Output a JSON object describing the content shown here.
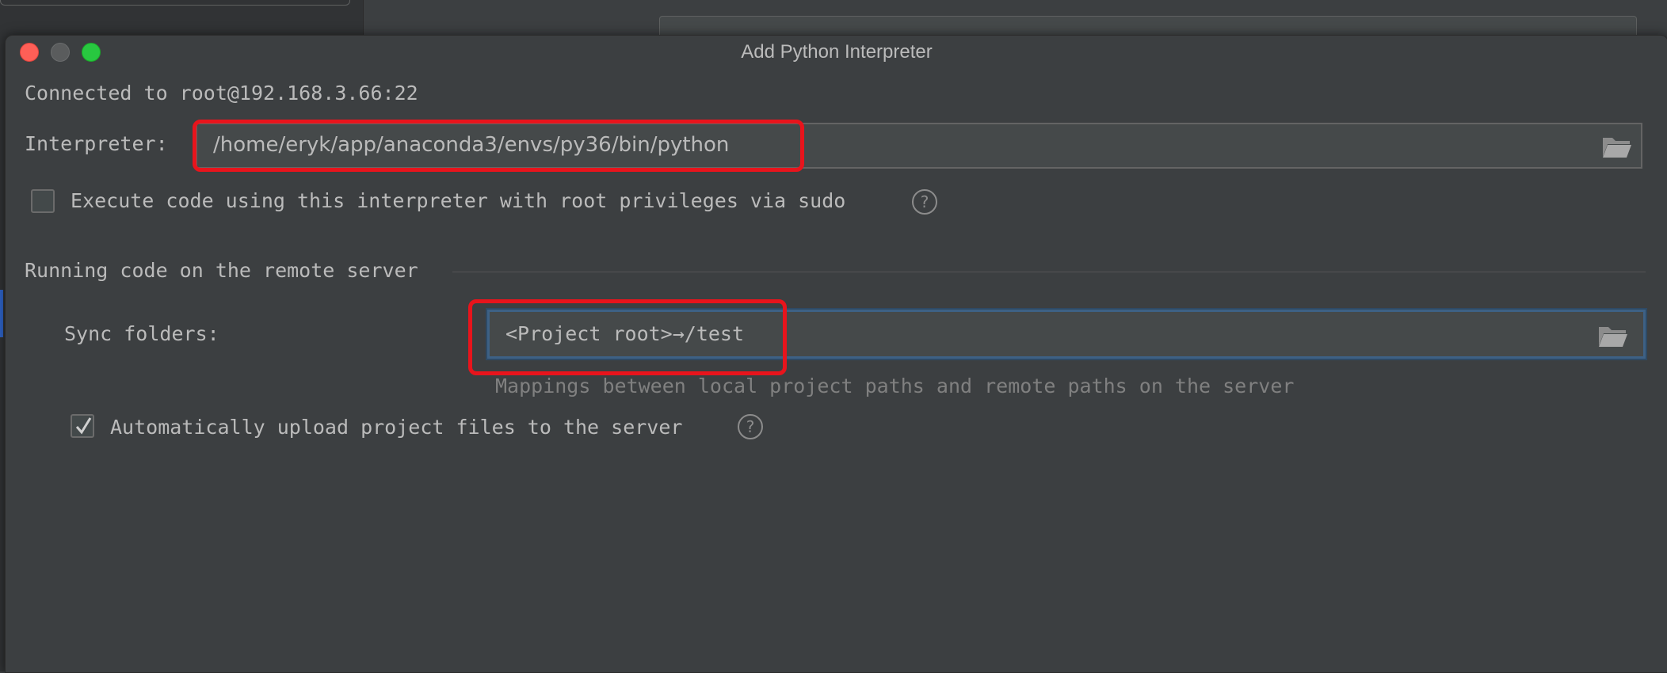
{
  "dialog": {
    "title": "Add Python Interpreter"
  },
  "connection": {
    "label": "Connected to root@192.168.3.66:22"
  },
  "interpreter": {
    "label": "Interpreter:",
    "value": "/home/eryk/app/anaconda3/envs/py36/bin/python"
  },
  "sudo": {
    "label": "Execute code using this interpreter with root privileges via sudo",
    "checked": false,
    "help": "?"
  },
  "remote_section": {
    "title": "Running code on the remote server"
  },
  "sync": {
    "label": "Sync folders:",
    "value": "<Project root>→/test",
    "hint": "Mappings between local project paths and remote paths on the server"
  },
  "upload": {
    "label": "Automatically upload project files to the server",
    "checked": true,
    "help": "?"
  },
  "icons": {
    "browse": "folder-open-icon",
    "help": "question-circle-icon",
    "check": "checkmark-icon"
  },
  "colors": {
    "annotation": "#e8141c",
    "background": "#3c3f41",
    "text": "#bbbbbb"
  }
}
